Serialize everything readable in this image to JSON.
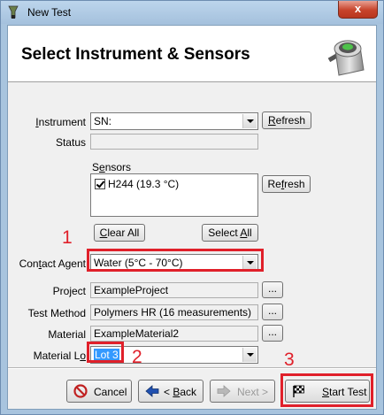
{
  "window": {
    "title": "New Test",
    "close_glyph": "x"
  },
  "header": {
    "title": "Select Instrument & Sensors"
  },
  "form": {
    "instrument": {
      "label_prefix": "",
      "label_underlined": "I",
      "label_rest": "nstrument",
      "value": "SN:",
      "refresh_u": "R",
      "refresh_rest": "efresh"
    },
    "status": {
      "label": "Status",
      "value": ""
    },
    "sensors": {
      "label_prefix": "S",
      "label_underlined": "e",
      "label_rest": "nsors",
      "items": [
        {
          "label": "H244 (19.3 °C)",
          "checked": true
        }
      ],
      "refresh_prefix": "Re",
      "refresh_u": "f",
      "refresh_rest": "resh",
      "clear_u": "C",
      "clear_rest": "lear All",
      "select_prefix": "Select ",
      "select_u": "A",
      "select_rest": "ll"
    },
    "contact_agent": {
      "label_prefix": "Con",
      "label_underlined": "t",
      "label_rest": "act Agent",
      "value": "Water (5°C - 70°C)"
    },
    "project": {
      "label": "Project",
      "value": "ExampleProject",
      "browse": "..."
    },
    "test_method": {
      "label": "Test Method",
      "value": "Polymers HR (16 measurements)",
      "browse": "..."
    },
    "material": {
      "label": "Material",
      "value": "ExampleMaterial2",
      "browse": "..."
    },
    "material_lot": {
      "label_prefix": "Material L",
      "label_underlined": "o",
      "label_rest": "",
      "value": "Lot 3"
    }
  },
  "footer": {
    "cancel": "Cancel",
    "back_prefix": "< ",
    "back_u": "B",
    "back_rest": "ack",
    "next": "Next >",
    "start_u": "S",
    "start_rest": "tart Test"
  },
  "annotations": {
    "n1": "1",
    "n2": "2",
    "n3": "3",
    "color": "#e0202a"
  }
}
